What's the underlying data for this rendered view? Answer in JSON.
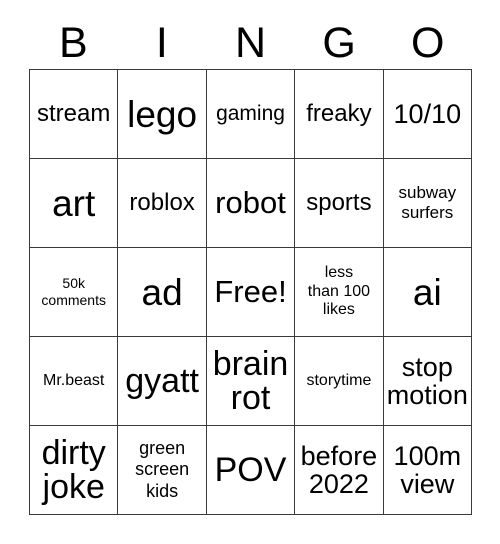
{
  "card": {
    "header_letters": [
      "B",
      "I",
      "N",
      "G",
      "O"
    ],
    "rows": [
      [
        {
          "text": "stream",
          "size": "s-xl"
        },
        {
          "text": "lego",
          "size": "s-5xl"
        },
        {
          "text": "gaming",
          "size": "s-lg"
        },
        {
          "text": "freaky",
          "size": "s-xl"
        },
        {
          "text": "10/10",
          "size": "s-2xl"
        }
      ],
      [
        {
          "text": "art",
          "size": "s-5xl"
        },
        {
          "text": "roblox",
          "size": "s-xl"
        },
        {
          "text": "robot",
          "size": "s-3xl"
        },
        {
          "text": "sports",
          "size": "s-xl"
        },
        {
          "text": "subway\nsurfers",
          "size": "s-smd"
        }
      ],
      [
        {
          "text": "50k\ncomments",
          "size": "s-xs"
        },
        {
          "text": "ad",
          "size": "s-5xl"
        },
        {
          "text": "Free!",
          "size": "s-3xl"
        },
        {
          "text": "less\nthan 100\nlikes",
          "size": "s-sm"
        },
        {
          "text": "ai",
          "size": "s-5xl"
        }
      ],
      [
        {
          "text": "Mr.beast",
          "size": "s-sm"
        },
        {
          "text": "gyatt",
          "size": "s-4xl"
        },
        {
          "text": "brain\nrot",
          "size": "s-4xl"
        },
        {
          "text": "storytime",
          "size": "s-sm"
        },
        {
          "text": "stop\nmotion",
          "size": "s-2xl"
        }
      ],
      [
        {
          "text": "dirty\njoke",
          "size": "s-4xl"
        },
        {
          "text": "green\nscreen\nkids",
          "size": "s-md"
        },
        {
          "text": "POV",
          "size": "s-4xl"
        },
        {
          "text": "before\n2022",
          "size": "s-2xl"
        },
        {
          "text": "100m\nview",
          "size": "s-2xl"
        }
      ]
    ],
    "free_space_text": "Free!",
    "colors": {
      "background": "#ffffff",
      "text": "#000000",
      "border": "#3a3a3a"
    }
  }
}
